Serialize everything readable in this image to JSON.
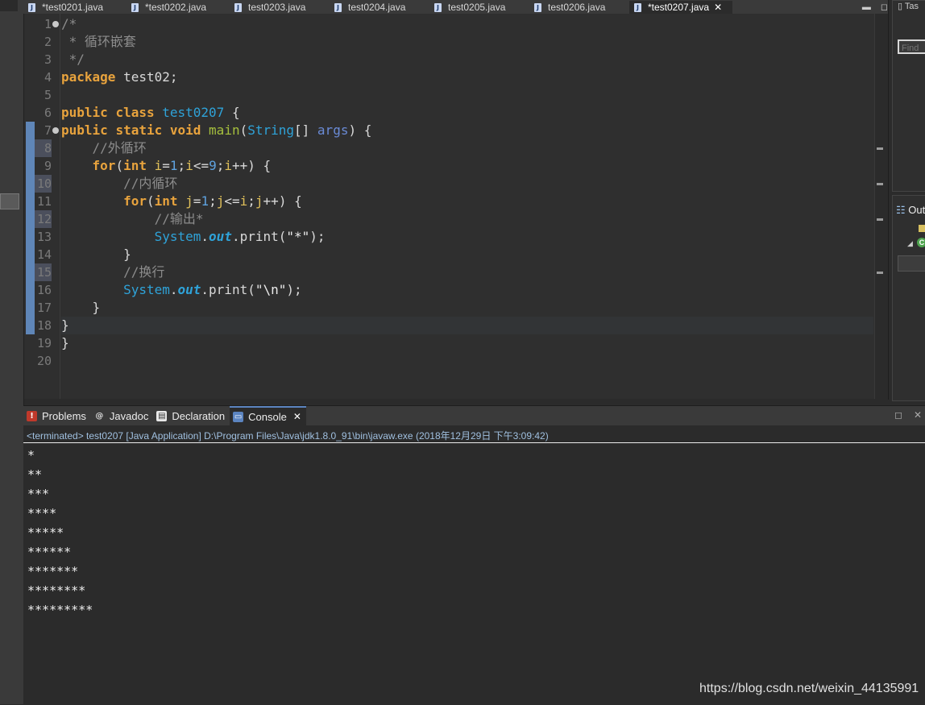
{
  "tabs": [
    {
      "label": "*test0201.java"
    },
    {
      "label": "*test0202.java"
    },
    {
      "label": "test0203.java"
    },
    {
      "label": "test0204.java"
    },
    {
      "label": "test0205.java"
    },
    {
      "label": "test0206.java"
    },
    {
      "label": "*test0207.java",
      "active": true
    }
  ],
  "right_panel": {
    "top_tab": "Tas",
    "find_placeholder": "Find",
    "outline_tab": "Out"
  },
  "code_lines": [
    {
      "n": "1"
    },
    {
      "n": "2"
    },
    {
      "n": "3"
    },
    {
      "n": "4"
    },
    {
      "n": "5"
    },
    {
      "n": "6"
    },
    {
      "n": "7"
    },
    {
      "n": "8"
    },
    {
      "n": "9"
    },
    {
      "n": "10"
    },
    {
      "n": "11"
    },
    {
      "n": "12"
    },
    {
      "n": "13"
    },
    {
      "n": "14"
    },
    {
      "n": "15"
    },
    {
      "n": "16"
    },
    {
      "n": "17"
    },
    {
      "n": "18"
    },
    {
      "n": "19"
    },
    {
      "n": "20"
    }
  ],
  "code": {
    "l1": "/*",
    "l2": " * 循环嵌套",
    "l3": " */",
    "l4_kw": "package",
    "l4_rest": " test02;",
    "l6_kw1": "public",
    "l6_kw2": "class",
    "l6_name": "test0207",
    "l6_brace": " {",
    "l7_kw1": "public",
    "l7_kw2": "static",
    "l7_kw3": "void",
    "l7_fn": "main",
    "l7_type": "String",
    "l7_arr": "[] ",
    "l7_arg": "args",
    "l7_end": ") {",
    "l8": "    //外循环",
    "l9_kw": "for",
    "l9_kw2": "int",
    "l11_kw": "for",
    "l11_kw2": "int",
    "l10": "        //内循环",
    "l12": "            //输出*",
    "l13_cls": "System",
    "l13_field": "out",
    "l13_call": ".print(",
    "l13_str": "\"*\"",
    "l13_end": ");",
    "l14": "        }",
    "l15": "        //换行",
    "l16_cls": "System",
    "l16_field": "out",
    "l16_call": ".print(",
    "l16_str": "\"\\n\"",
    "l16_end": ");",
    "l17": "    }",
    "l18": "}",
    "l19": "}"
  },
  "console_tabs": [
    {
      "label": "Problems"
    },
    {
      "label": "Javadoc"
    },
    {
      "label": "Declaration"
    },
    {
      "label": "Console",
      "active": true
    }
  ],
  "console": {
    "terminated": "<terminated> test0207 [Java Application] D:\\Program Files\\Java\\jdk1.8.0_91\\bin\\javaw.exe (2018年12月29日 下午3:09:42)",
    "output": [
      "*",
      "**",
      "***",
      "****",
      "*****",
      "******",
      "*******",
      "********",
      "*********"
    ]
  },
  "watermark": "https://blog.csdn.net/weixin_44135991",
  "colors": {
    "background": "#2b2b2b",
    "keyword": "#e8a33d",
    "class_name": "#2fa3d9",
    "comment": "#8c8c8c",
    "number": "#5fa3e0",
    "active_tab_border": "#5b84c0"
  }
}
